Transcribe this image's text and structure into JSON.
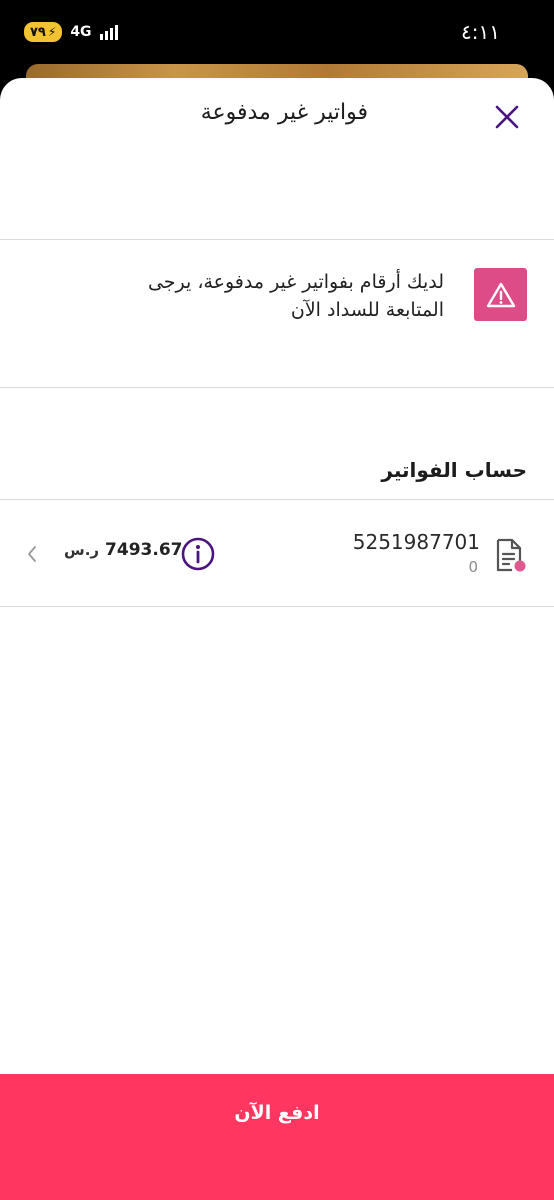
{
  "status_bar": {
    "time": "٤:١١",
    "battery": "٧٩",
    "network": "4G"
  },
  "sheet": {
    "title": "فواتير غير مدفوعة",
    "close_icon": "close-icon"
  },
  "alert": {
    "icon": "warning-icon",
    "message": "لديك أرقام بفواتير غير مدفوعة، يرجى المتابعة للسداد الآن",
    "color": "#dd4c87"
  },
  "bills": {
    "section_title": "حساب الفواتير",
    "items": [
      {
        "account_number": "5251987701",
        "sub_value": "0",
        "amount": "7493.67",
        "currency": "ر.س"
      }
    ]
  },
  "pay_button": {
    "label": "ادفع الآن",
    "color": "#ff3660"
  },
  "colors": {
    "accent_purple": "#4b1581",
    "status_dot": "#e05a8f"
  }
}
